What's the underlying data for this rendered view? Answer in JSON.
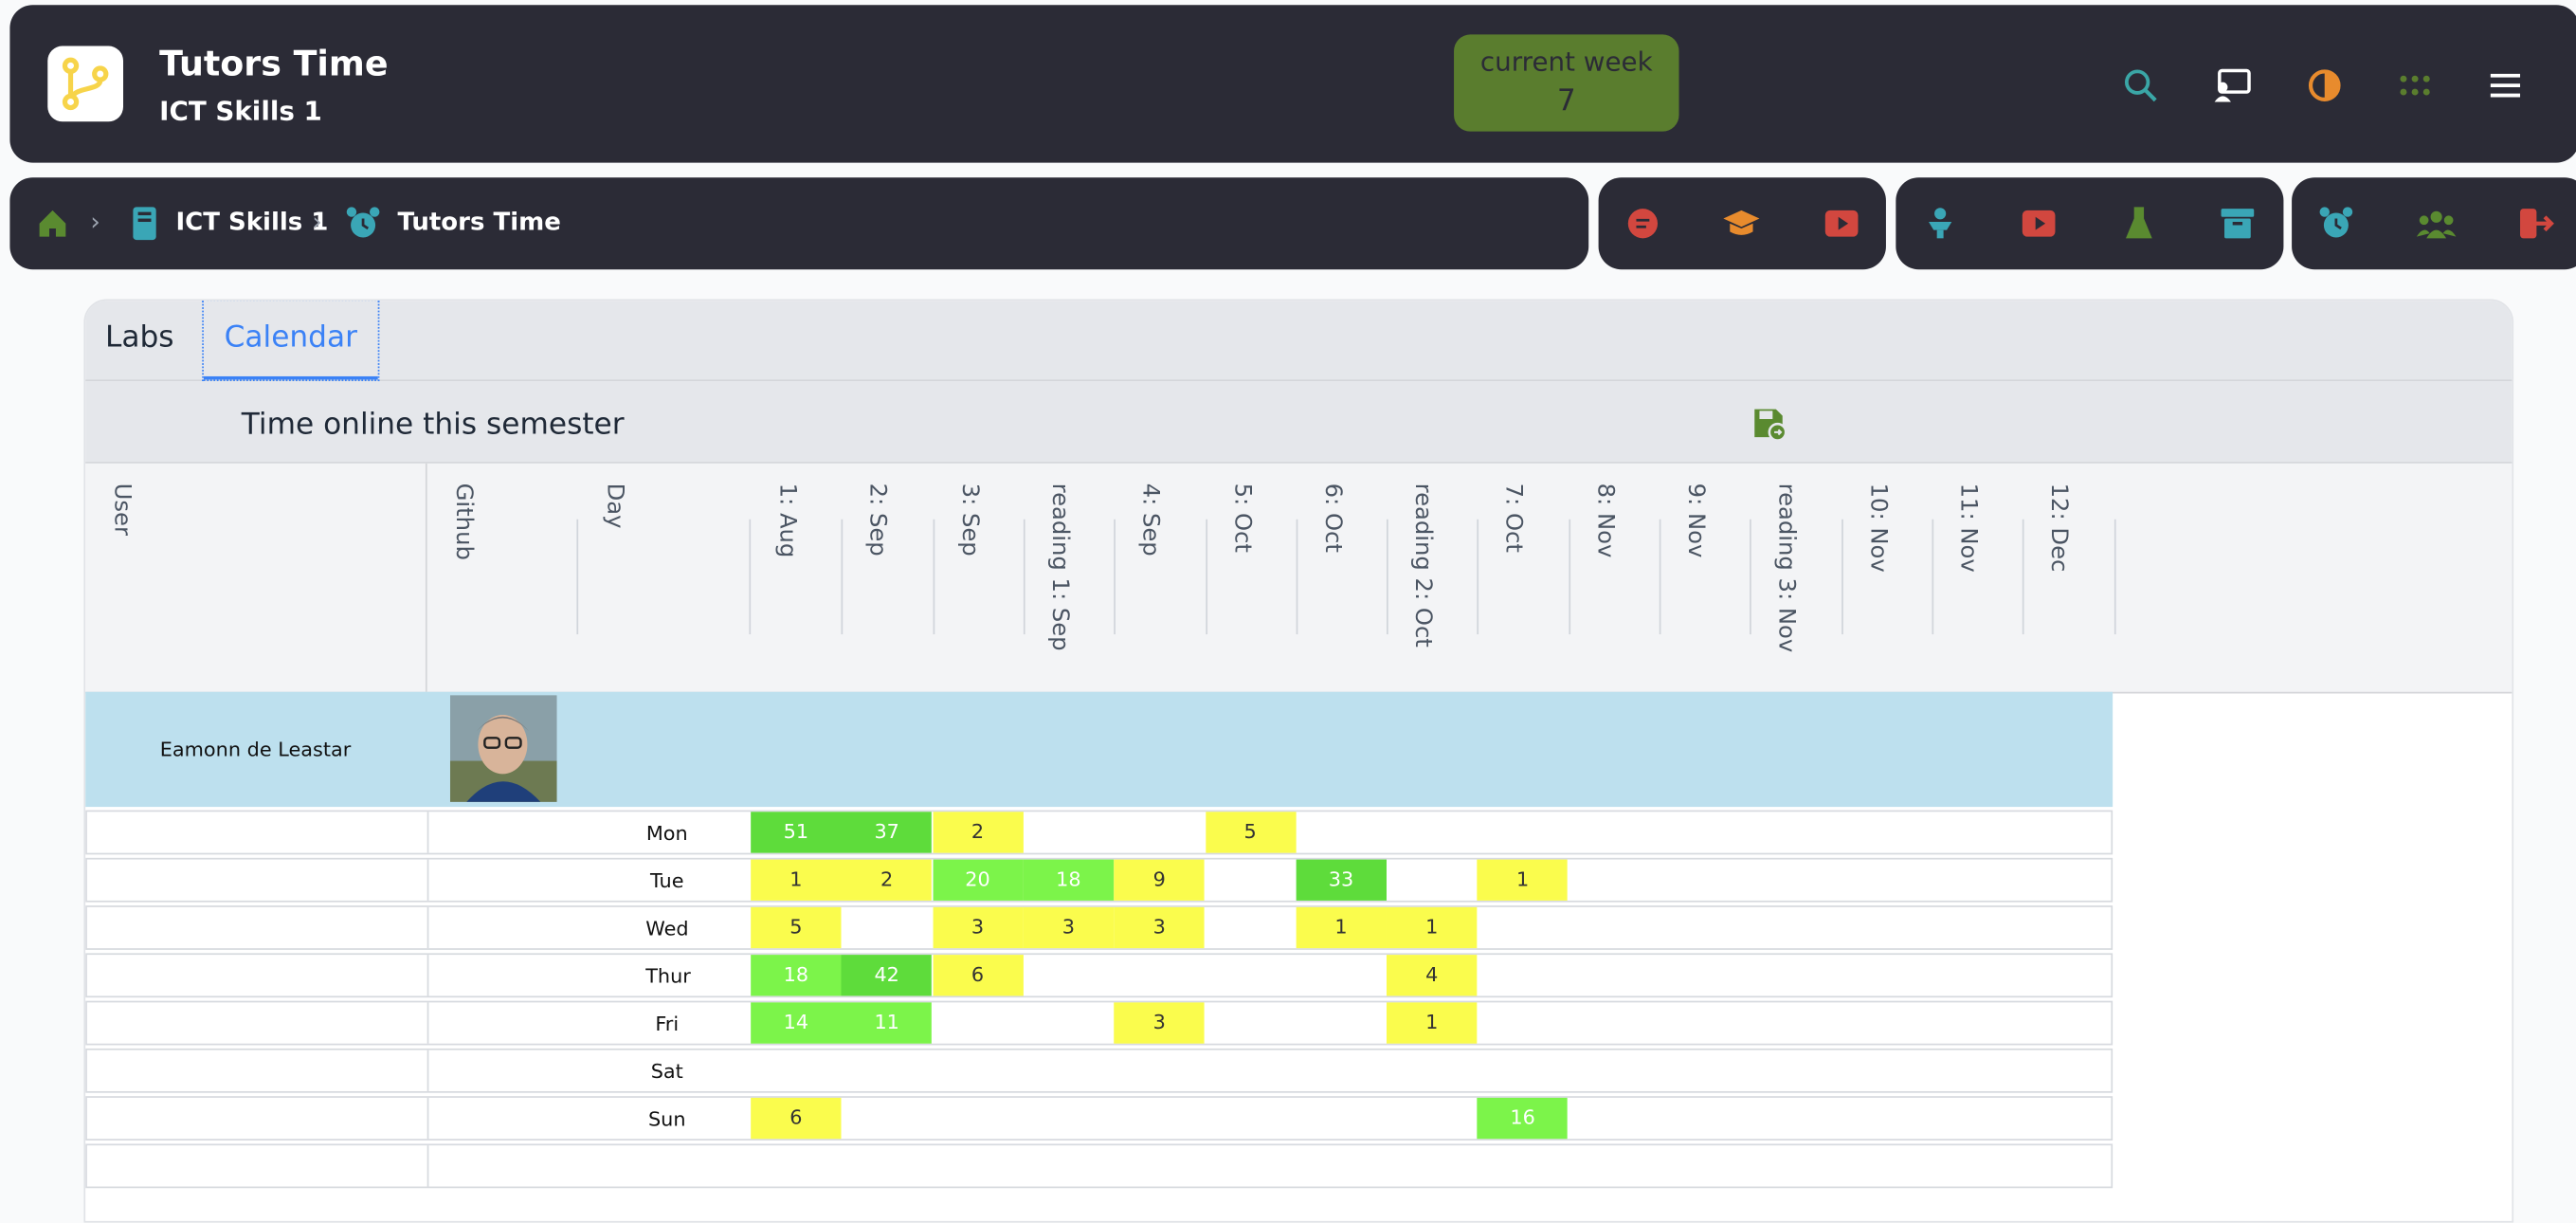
{
  "app": {
    "title": "Tutors Time",
    "subtitle": "ICT Skills 1"
  },
  "current_week": {
    "label": "current week",
    "value": "7"
  },
  "breadcrumb": {
    "course": "ICT Skills 1",
    "page": "Tutors Time"
  },
  "tabs": {
    "labs": "Labs",
    "calendar": "Calendar"
  },
  "section": {
    "title": "Time online this semester"
  },
  "columns": {
    "user": "User",
    "github": "Github",
    "day": "Day",
    "weeks": [
      "1: Aug",
      "2: Sep",
      "3: Sep",
      "reading 1: Sep",
      "4: Sep",
      "5: Oct",
      "6: Oct",
      "reading 2: Oct",
      "7: Oct",
      "8: Nov",
      "9: Nov",
      "reading 3: Nov",
      "10: Nov",
      "11: Nov",
      "12: Dec"
    ]
  },
  "user": {
    "name": "Eamonn de Leastar"
  },
  "days": [
    {
      "label": "Mon",
      "values": [
        "51",
        "37",
        "2",
        "",
        "",
        "5",
        "",
        "",
        "",
        "",
        "",
        "",
        "",
        "",
        ""
      ]
    },
    {
      "label": "Tue",
      "values": [
        "1",
        "2",
        "20",
        "18",
        "9",
        "",
        "33",
        "",
        "1",
        "",
        "",
        "",
        "",
        "",
        ""
      ]
    },
    {
      "label": "Wed",
      "values": [
        "5",
        "",
        "3",
        "3",
        "3",
        "",
        "1",
        "1",
        "",
        "",
        "",
        "",
        "",
        "",
        ""
      ]
    },
    {
      "label": "Thur",
      "values": [
        "18",
        "42",
        "6",
        "",
        "",
        "",
        "",
        "4",
        "",
        "",
        "",
        "",
        "",
        "",
        ""
      ]
    },
    {
      "label": "Fri",
      "values": [
        "14",
        "11",
        "",
        "",
        "3",
        "",
        "",
        "1",
        "",
        "",
        "",
        "",
        "",
        "",
        ""
      ]
    },
    {
      "label": "Sat",
      "values": [
        "",
        "",
        "",
        "",
        "",
        "",
        "",
        "",
        "",
        "",
        "",
        "",
        "",
        "",
        ""
      ]
    },
    {
      "label": "Sun",
      "values": [
        "6",
        "",
        "",
        "",
        "",
        "",
        "",
        "",
        "16",
        "",
        "",
        "",
        "",
        "",
        ""
      ]
    }
  ],
  "colors": {
    "dark": "#2b2b36",
    "week_badge": "#5a7d2e",
    "user_row": "#bde0ee",
    "low": "#fafc4d",
    "mid": "#7cf44a",
    "high": "#5edc3b"
  }
}
